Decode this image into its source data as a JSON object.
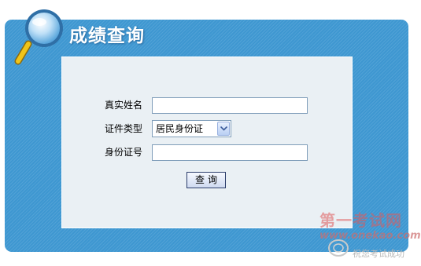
{
  "header": {
    "title": "成绩查询",
    "icon": "magnifier-icon"
  },
  "form": {
    "name_label": "真实姓名",
    "name_value": "",
    "id_type_label": "证件类型",
    "id_type_selected": "居民身份证",
    "id_number_label": "身份证号",
    "id_number_value": "",
    "submit_label": "查询"
  },
  "watermark": {
    "title": "第一考试网",
    "url": "www.onekao.com",
    "slogan": "祝您考试成功"
  },
  "colors": {
    "panel": "#3e97d1",
    "content_bg": "#eaf0f4",
    "input_border": "#7f9db9"
  }
}
